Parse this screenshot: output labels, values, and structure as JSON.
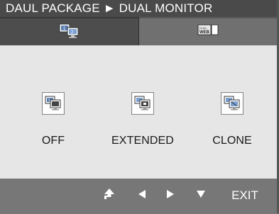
{
  "menu": {
    "breadcrumb": "DAUL PACKAGE ► DUAL MONITOR"
  },
  "tabs": [
    {
      "icon": "dual-monitor-icon",
      "active": true
    },
    {
      "icon": "dual-web-icon",
      "active": false
    }
  ],
  "options": [
    {
      "label": "OFF",
      "icon": "monitor-off-icon"
    },
    {
      "label": "EXTENDED",
      "icon": "monitor-extended-icon"
    },
    {
      "label": "CLONE",
      "icon": "monitor-clone-icon"
    }
  ],
  "nav": {
    "exit_label": "EXIT"
  },
  "colors": {
    "title_bg": "#4a4a4a",
    "tab_active": "#4d4d4d",
    "tab_inactive": "#707070",
    "content_bg": "#e6e6e6",
    "footer_bg": "#777777"
  }
}
